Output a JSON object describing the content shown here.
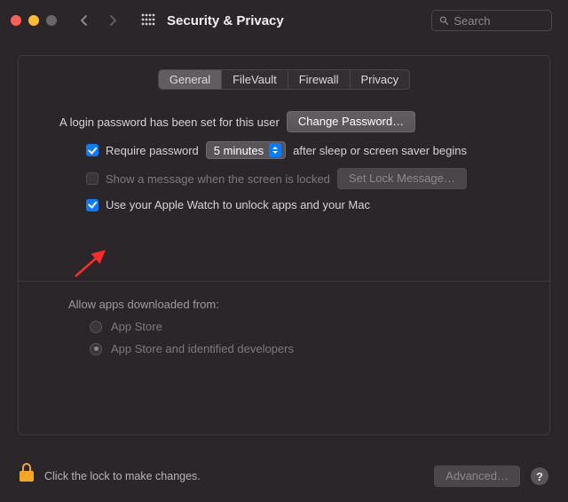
{
  "window": {
    "title": "Security & Privacy"
  },
  "search": {
    "placeholder": "Search",
    "value": ""
  },
  "tabs": {
    "items": [
      "General",
      "FileVault",
      "Firewall",
      "Privacy"
    ],
    "active": 0
  },
  "general": {
    "login_password_set": "A login password has been set for this user",
    "change_password": "Change Password…",
    "require_password_label": "Require password",
    "require_password_checked": true,
    "delay_options_visible": "5 minutes",
    "require_password_tail": "after sleep or screen saver begins",
    "show_message_label": "Show a message when the screen is locked",
    "show_message_checked": false,
    "set_lock_message": "Set Lock Message…",
    "apple_watch_label": "Use your Apple Watch to unlock apps and your Mac",
    "apple_watch_checked": true
  },
  "downloads": {
    "heading": "Allow apps downloaded from:",
    "option_appstore": "App Store",
    "option_identified": "App Store and identified developers",
    "selected": 1
  },
  "footer": {
    "lock_text": "Click the lock to make changes.",
    "advanced": "Advanced…",
    "help": "?"
  }
}
